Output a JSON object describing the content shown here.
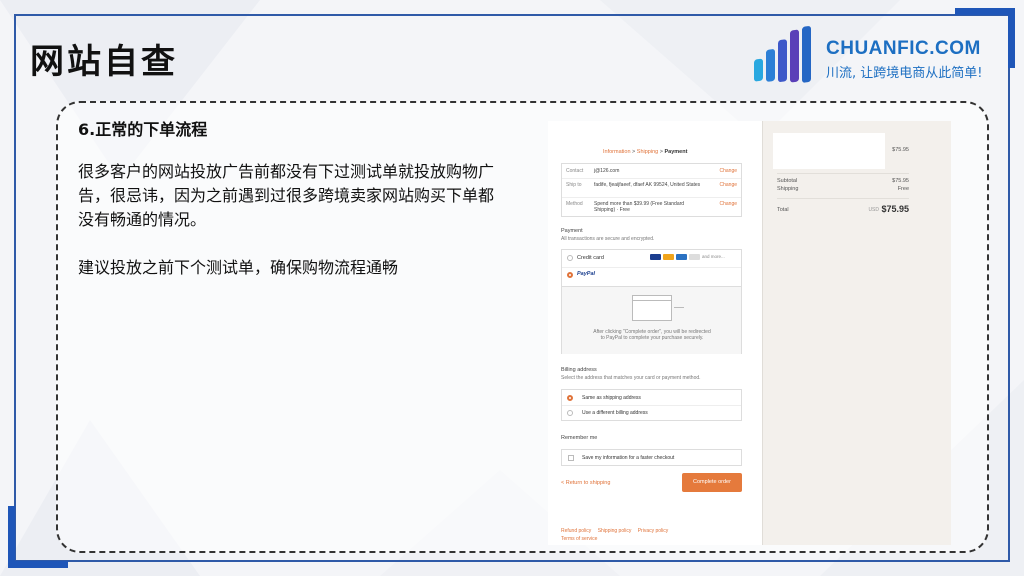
{
  "slide": {
    "title": "网站自查",
    "brand": {
      "name": "CHUANFIC.COM",
      "slogan": "川流, 让跨境电商从此简单!",
      "color": "#1d6fc2"
    },
    "heading": "6.正常的下单流程",
    "paragraph1": "很多客户的网站投放广告前都没有下过测试单就投放购物广告，很忌讳，因为之前遇到过很多跨境卖家网站购买下单都没有畅通的情况。",
    "paragraph2": "建议投放之前下个测试单，确保购物流程通畅",
    "accent_color": "#1f56b8"
  },
  "checkout": {
    "breadcrumb": {
      "information": "Information",
      "shipping": "Shipping",
      "payment": "Payment",
      "separator": ">"
    },
    "info": [
      {
        "key": "Contact",
        "value": "j@126.com",
        "action": "Change"
      },
      {
        "key": "Ship to",
        "value": "fadife, fjeaijfaeef, dfaef AK 99524, United States",
        "action": "Change"
      },
      {
        "key": "Method",
        "value": "Spend more than $39.99 (Free Standard Shipping) · Free",
        "action": "Change"
      }
    ],
    "payment": {
      "title": "Payment",
      "subtitle": "All transactions are secure and encrypted.",
      "credit_card": "Credit card",
      "more": "and more...",
      "paypal": "PayPal",
      "paypal_note": "After clicking \"Complete order\", you will be redirected to PayPal to complete your purchase securely."
    },
    "billing": {
      "title": "Billing address",
      "subtitle": "Select the address that matches your card or payment method.",
      "same": "Same as shipping address",
      "different": "Use a different billing address"
    },
    "remember": {
      "title": "Remember me",
      "option": "Save my information for a faster checkout"
    },
    "return_link": "< Return to shipping",
    "complete_button": "Complete order",
    "footer": {
      "refund": "Refund policy",
      "shipping": "Shipping policy",
      "privacy": "Privacy policy",
      "terms": "Terms of service"
    },
    "summary": {
      "item_price": "$75.95",
      "subtotal_label": "Subtotal",
      "subtotal": "$75.95",
      "shipping_label": "Shipping",
      "shipping": "Free",
      "total_label": "Total",
      "currency": "USD",
      "total": "$75.95"
    },
    "accent_color": "#e57a3c"
  }
}
